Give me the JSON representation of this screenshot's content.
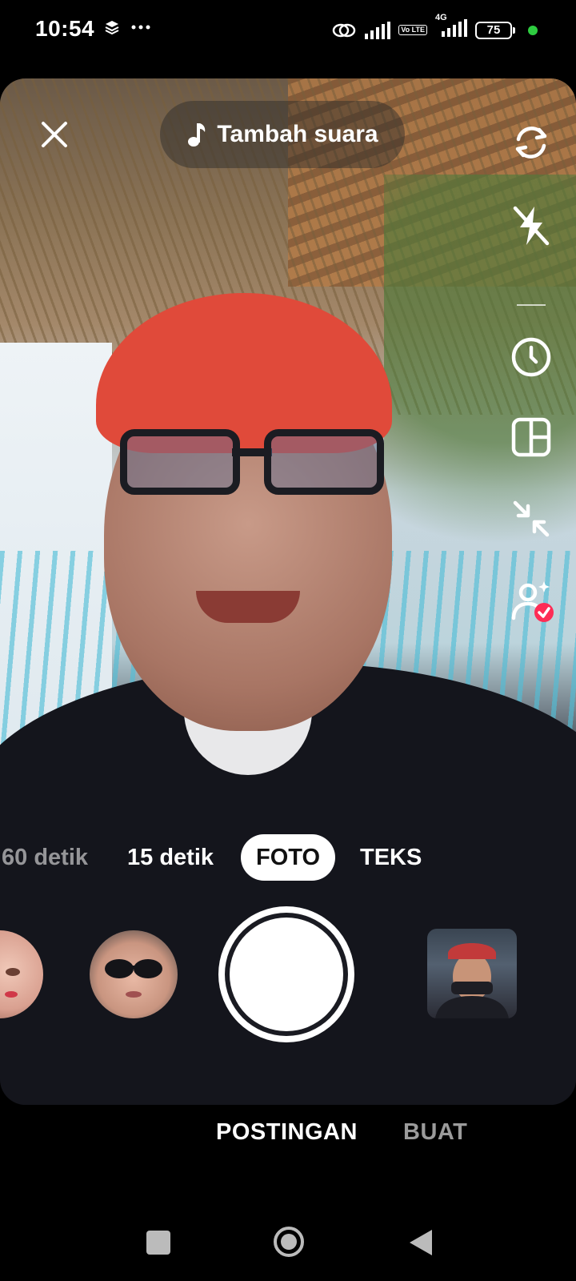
{
  "status_bar": {
    "time": "10:54",
    "battery_level": "75",
    "network": "4G",
    "volte": "Vo LTE",
    "icons": [
      "layers-icon",
      "more-dots-icon",
      "link-icon",
      "signal-icon",
      "signal-icon",
      "battery-icon",
      "dot-icon"
    ]
  },
  "camera": {
    "close_icon": "close-icon",
    "add_sound": {
      "icon": "music-note-icon",
      "label": "Tambah suara"
    },
    "side_tools": [
      "flip-camera-icon",
      "flash-off-icon",
      "timer-icon",
      "layout-icon",
      "collapse-icon",
      "beauty-filter-icon"
    ],
    "modes": {
      "partial": "60 detik",
      "fifteen": "15 detik",
      "active": "FOTO",
      "text": "TEKS"
    },
    "effects": [
      {
        "name": "effect-thumbnail-face"
      },
      {
        "name": "effect-thumbnail-sunglasses"
      }
    ],
    "gallery_thumb": "gallery-thumbnail"
  },
  "bottom_tabs": {
    "post": "POSTINGAN",
    "create": "BUAT"
  },
  "navbar": {
    "icons": [
      "recent-apps-icon",
      "home-icon",
      "back-icon"
    ]
  },
  "colors": {
    "accent_red": "#fe2c55",
    "status_green": "#2ecc40",
    "inactive_tab": "#9b9b9b"
  }
}
